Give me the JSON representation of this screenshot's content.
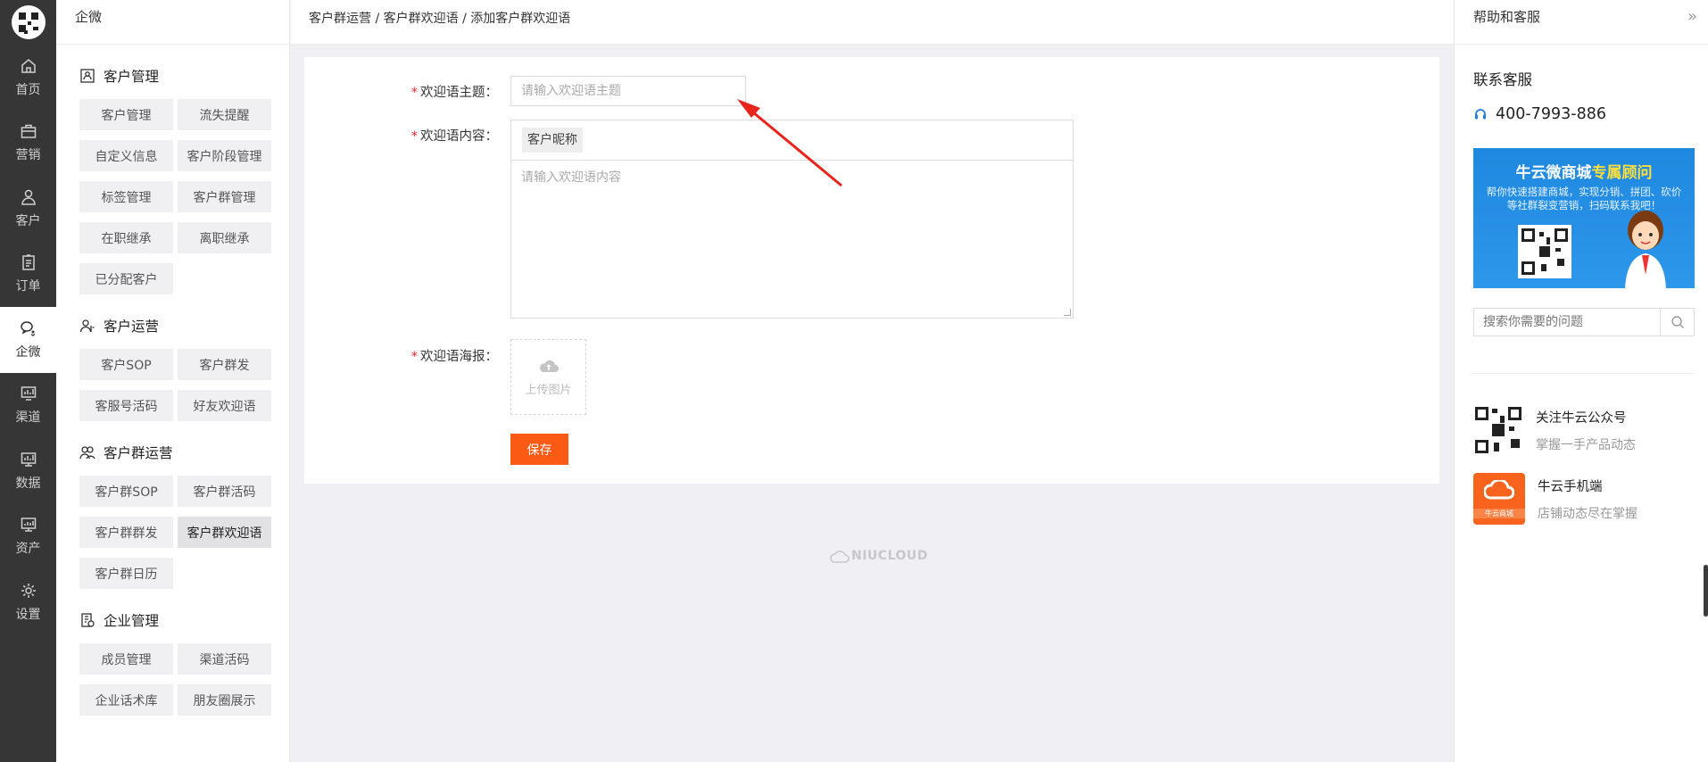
{
  "rail": {
    "items": [
      {
        "label": "首页",
        "icon": "home-icon"
      },
      {
        "label": "营销",
        "icon": "briefcase-icon"
      },
      {
        "label": "客户",
        "icon": "user-icon"
      },
      {
        "label": "订单",
        "icon": "clipboard-icon"
      },
      {
        "label": "企微",
        "icon": "wechat-icon",
        "active": true
      },
      {
        "label": "渠道",
        "icon": "chart-icon"
      },
      {
        "label": "数据",
        "icon": "monitor-chart-icon"
      },
      {
        "label": "资产",
        "icon": "monitor-icon"
      },
      {
        "label": "设置",
        "icon": "gear-icon"
      }
    ]
  },
  "menu": {
    "title": "企微",
    "groups": [
      {
        "title": "客户管理",
        "icon": "contact-card-icon",
        "items": [
          "客户管理",
          "流失提醒",
          "自定义信息",
          "客户阶段管理",
          "标签管理",
          "客户群管理",
          "在职继承",
          "离职继承",
          "已分配客户"
        ]
      },
      {
        "title": "客户运营",
        "icon": "user-operate-icon",
        "items": [
          "客户SOP",
          "客户群发",
          "客服号活码",
          "好友欢迎语"
        ]
      },
      {
        "title": "客户群运营",
        "icon": "group-icon",
        "items": [
          "客户群SOP",
          "客户群活码",
          "客户群群发",
          "客户群欢迎语",
          "客户群日历"
        ],
        "active": "客户群欢迎语"
      },
      {
        "title": "企业管理",
        "icon": "enterprise-icon",
        "items": [
          "成员管理",
          "渠道活码",
          "企业话术库",
          "朋友圈展示"
        ]
      }
    ]
  },
  "breadcrumb": "客户群运营 / 客户群欢迎语 / 添加客户群欢迎语",
  "form": {
    "subject_label": "欢迎语主题：",
    "subject_placeholder": "请输入欢迎语主题",
    "content_label": "欢迎语内容：",
    "content_tag": "客户昵称",
    "content_placeholder": "请输入欢迎语内容",
    "poster_label": "欢迎语海报：",
    "upload_label": "上传图片",
    "save_label": "保存",
    "required_mark": "*"
  },
  "watermark": "NIUCLOUD",
  "help": {
    "title": "帮助和客服",
    "collapse_icon": "double-chevron-right-icon",
    "contact_title": "联系客服",
    "phone": "400-7993-886",
    "banner_title_a": "牛云微商城",
    "banner_title_b": "专属顾问",
    "banner_sub": "帮你快速搭建商城，实现分销、拼团、砍价等社群裂变营销，扫码联系我吧！",
    "search_placeholder": "搜索你需要的问题",
    "follow_items": [
      {
        "title": "关注牛云公众号",
        "sub": "掌握一手产品动态"
      },
      {
        "title": "牛云手机端",
        "sub": "店铺动态尽在掌握"
      }
    ],
    "app_caption": "牛云商城"
  },
  "colors": {
    "accent": "#fa5a14",
    "rail_bg": "#363636",
    "banner": "#1f88e0",
    "required": "#f5222d"
  }
}
